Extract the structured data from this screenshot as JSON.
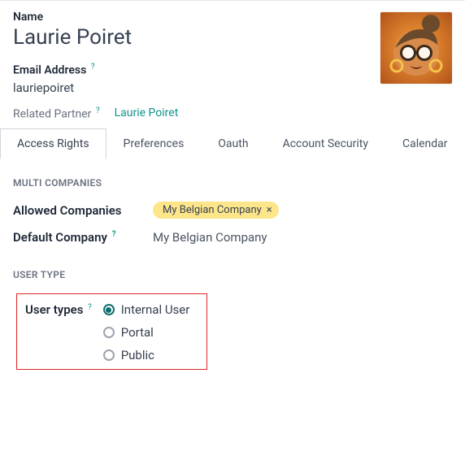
{
  "header": {
    "name_label": "Name",
    "name_value": "Laurie Poiret",
    "email_label": "Email Address",
    "email_value": "lauriepoiret",
    "related_label": "Related Partner",
    "related_value": "Laurie Poiret",
    "help_glyph": "?"
  },
  "tabs": [
    {
      "label": "Access Rights",
      "active": true
    },
    {
      "label": "Preferences",
      "active": false
    },
    {
      "label": "Oauth",
      "active": false
    },
    {
      "label": "Account Security",
      "active": false
    },
    {
      "label": "Calendar",
      "active": false
    }
  ],
  "multi_companies": {
    "section_title": "MULTI COMPANIES",
    "allowed_label": "Allowed Companies",
    "allowed_tag": "My Belgian Company",
    "tag_remove": "×",
    "default_label": "Default Company",
    "default_value": "My Belgian Company"
  },
  "user_type": {
    "section_title": "USER TYPE",
    "field_label": "User types",
    "options": [
      {
        "label": "Internal User",
        "selected": true
      },
      {
        "label": "Portal",
        "selected": false
      },
      {
        "label": "Public",
        "selected": false
      }
    ]
  }
}
